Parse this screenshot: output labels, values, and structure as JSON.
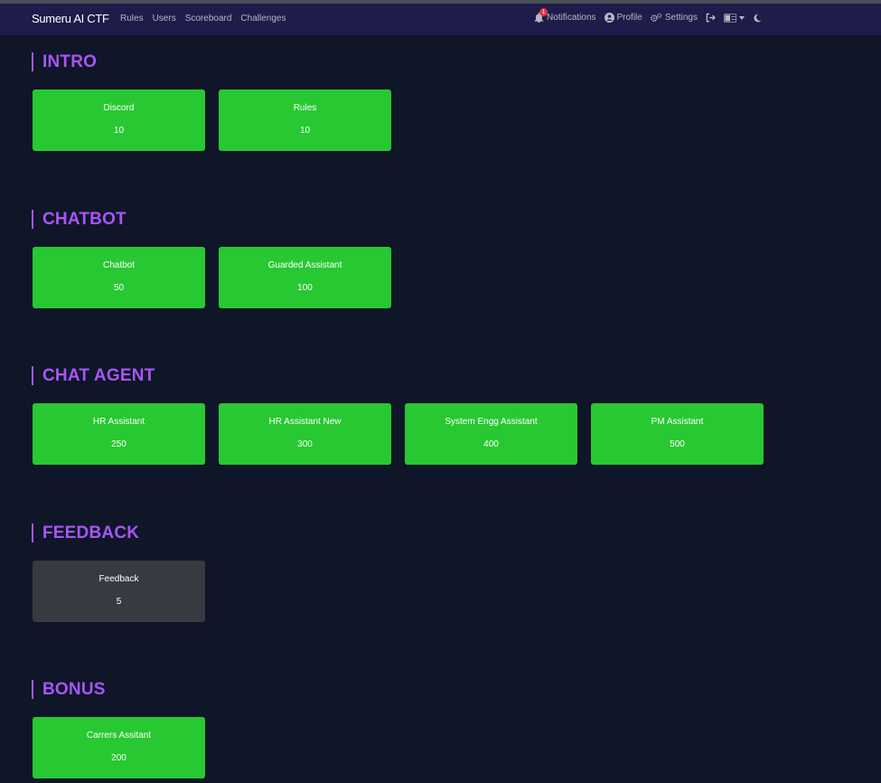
{
  "navbar": {
    "brand": "Sumeru AI CTF",
    "links": [
      "Rules",
      "Users",
      "Scoreboard",
      "Challenges"
    ],
    "notifications_label": "Notifications",
    "notifications_count": "1",
    "profile_label": "Profile",
    "settings_label": "Settings"
  },
  "colors": {
    "navbar_bg": "#1f1b4a",
    "page_bg": "#0e1628",
    "accent": "#a855f7",
    "unsolved_card": "#28c832",
    "solved_card": "#373a40"
  },
  "sections": [
    {
      "title": "INTRO",
      "challenges": [
        {
          "name": "Discord",
          "points": "10",
          "solved": false
        },
        {
          "name": "Rules",
          "points": "10",
          "solved": false
        }
      ]
    },
    {
      "title": "CHATBOT",
      "challenges": [
        {
          "name": "Chatbot",
          "points": "50",
          "solved": false
        },
        {
          "name": "Guarded Assistant",
          "points": "100",
          "solved": false
        }
      ]
    },
    {
      "title": "CHAT AGENT",
      "challenges": [
        {
          "name": "HR Assistant",
          "points": "250",
          "solved": false
        },
        {
          "name": "HR Assistant New",
          "points": "300",
          "solved": false
        },
        {
          "name": "System Engg Assistant",
          "points": "400",
          "solved": false
        },
        {
          "name": "PM Assistant",
          "points": "500",
          "solved": false
        }
      ]
    },
    {
      "title": "FEEDBACK",
      "challenges": [
        {
          "name": "Feedback",
          "points": "5",
          "solved": true
        }
      ]
    },
    {
      "title": "BONUS",
      "challenges": [
        {
          "name": "Carrers Assitant",
          "points": "200",
          "solved": false
        }
      ]
    }
  ]
}
